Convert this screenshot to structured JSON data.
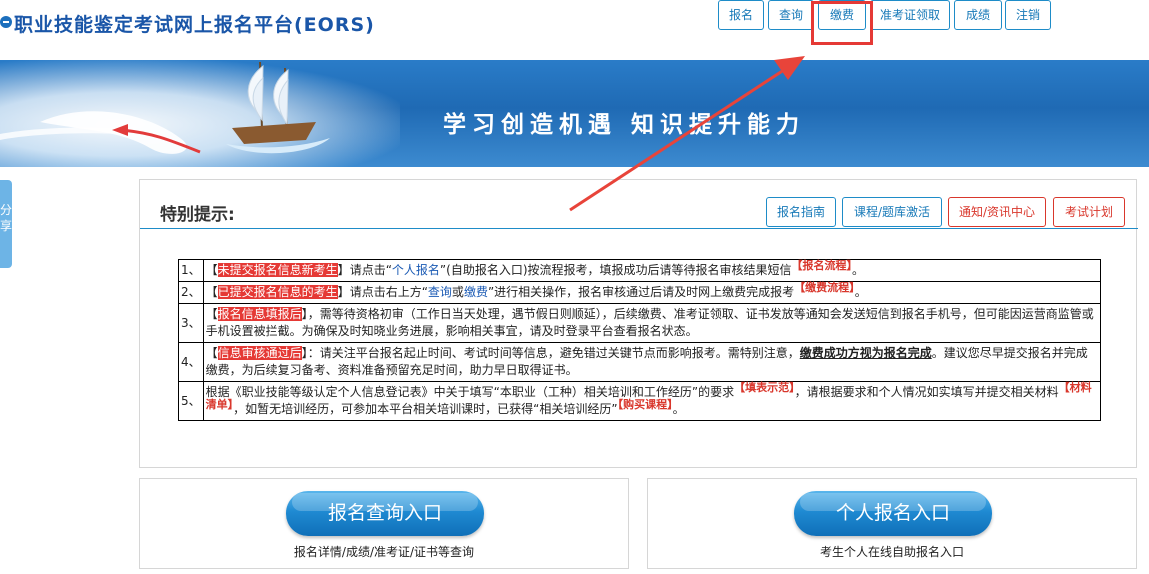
{
  "header": {
    "title": "职业技能鉴定考试网上报名平台(EORS)",
    "nav": [
      "报名",
      "查询",
      "缴费",
      "准考证领取",
      "成绩",
      "注销"
    ]
  },
  "banner": {
    "slogan": "学习创造机遇  知识提升能力"
  },
  "side_tab": {
    "label": "分享"
  },
  "notice": {
    "title": "特别提示:",
    "buttons": [
      "报名指南",
      "课程/题库激活",
      "通知/资讯中心",
      "考试计划"
    ],
    "items": [
      {
        "num": "1、",
        "open": "【",
        "tag": "未提交报名信息新考生",
        "close": "】",
        "t1": "请点击“",
        "link1": "个人报名",
        "t2": "”(自助报名入口)按流程报考，填报成功后请等待报名审核结果短信",
        "sup": "【报名流程】",
        "end": "。"
      },
      {
        "num": "2、",
        "open": "【",
        "tag": "已提交报名信息的考生",
        "close": "】",
        "t1": "请点击右上方“",
        "link1": "查询",
        "or": "或",
        "link2": "缴费",
        "t2": "”进行相关操作，报名审核通过后请及时网上缴费完成报考",
        "sup": "【缴费流程】",
        "end": "。"
      },
      {
        "num": "3、",
        "open": "【",
        "tag": "报名信息填报后",
        "close": "】",
        "t1": "，需等待资格初审（工作日当天处理，遇节假日则顺延），后续缴费、准考证领取、证书发放等通知会发送短信到报名手机号，但可能因运营商监管或手机设置被拦截。为确保及时知晓业务进展，影响相关事宜，请及时登录平台查看报名状态。"
      },
      {
        "num": "4、",
        "open": "【",
        "tag": "信息审核通过后",
        "close": "】",
        "t1": "：请关注平台报名起止时间、考试时间等信息，避免错过关键节点而影响报考。需特别注意，",
        "emph": "缴费成功方视为报名完成",
        "t2": "。建议您尽早提交报名并完成缴费，为后续复习备考、资料准备预留充足时间，助力早日取得证书。"
      },
      {
        "num": "5、",
        "t1": "根据《职业技能等级认定个人信息登记表》中关于填写“本职业（工种）相关培训和工作经历”的要求",
        "sup1": "【填表示范】",
        "t2": "，请根据要求和个人情况如实填写并提交相关材料",
        "sup2": "【材料清单】",
        "t3": "，如暂无培训经历，可参加本平台相关培训课时，已获得“相关培训经历”",
        "sup3": "【购买课程】",
        "end": "。"
      }
    ]
  },
  "entries": [
    {
      "button": "报名查询入口",
      "desc": "报名详情/成绩/准考证/证书等查询"
    },
    {
      "button": "个人报名入口",
      "desc": "考生个人在线自助报名入口"
    }
  ],
  "colors": {
    "accent": "#1e8cc8",
    "highlight": "#e53935",
    "banner": "#2a7cc8"
  }
}
